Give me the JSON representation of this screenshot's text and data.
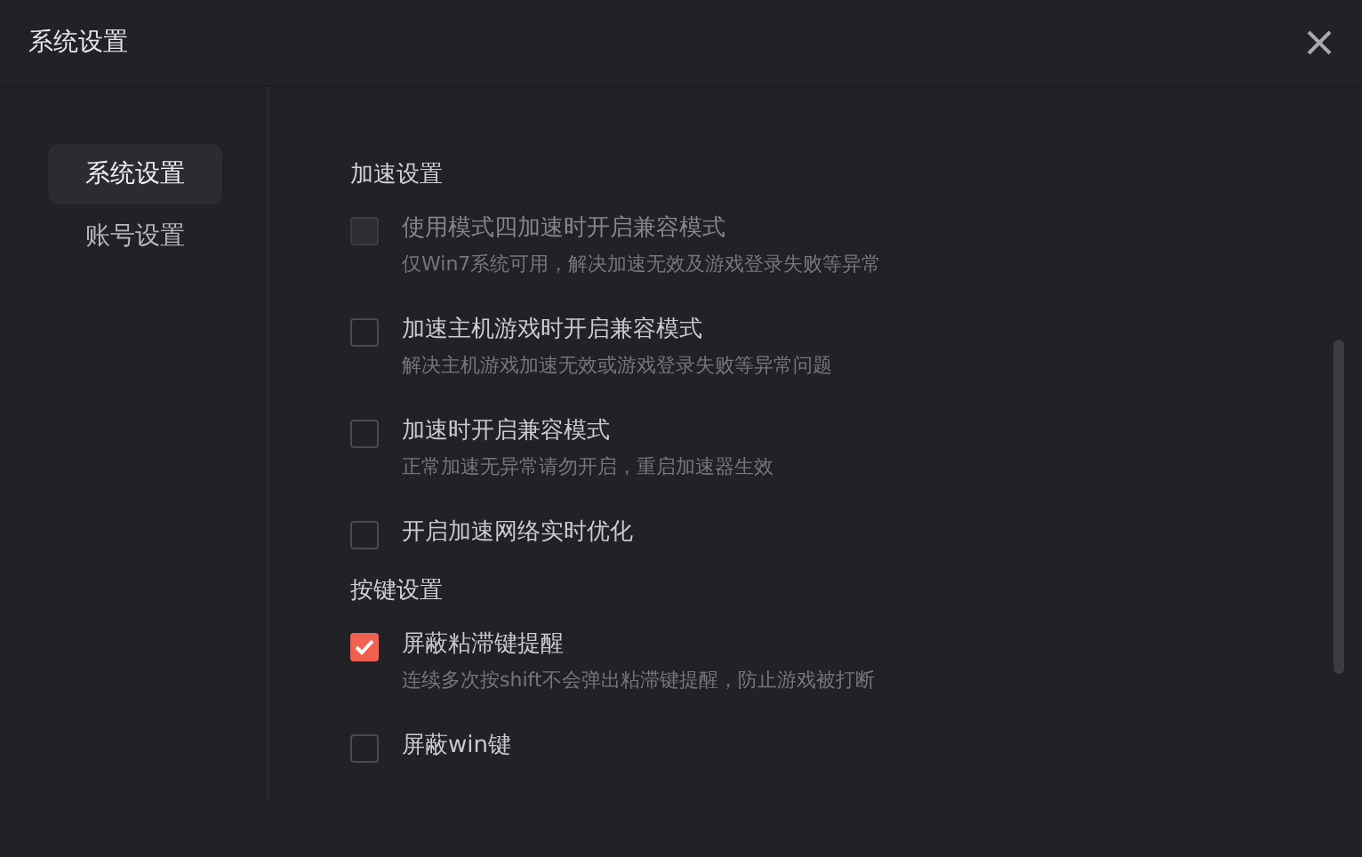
{
  "window": {
    "title": "系统设置"
  },
  "sidebar": {
    "items": [
      {
        "label": "系统设置",
        "selected": true
      },
      {
        "label": "账号设置",
        "selected": false
      }
    ]
  },
  "sections": [
    {
      "title": "加速设置",
      "options": [
        {
          "label": "使用模式四加速时开启兼容模式",
          "description": "仅Win7系统可用，解决加速无效及游戏登录失败等异常",
          "checked": false,
          "disabled": true
        },
        {
          "label": "加速主机游戏时开启兼容模式",
          "description": "解决主机游戏加速无效或游戏登录失败等异常问题",
          "checked": false,
          "disabled": false
        },
        {
          "label": "加速时开启兼容模式",
          "description": "正常加速无异常请勿开启，重启加速器生效",
          "checked": false,
          "disabled": false
        },
        {
          "label": "开启加速网络实时优化",
          "checked": false,
          "disabled": false
        }
      ]
    },
    {
      "title": "按键设置",
      "options": [
        {
          "label": "屏蔽粘滞键提醒",
          "description": "连续多次按shift不会弹出粘滞键提醒，防止游戏被打断",
          "checked": true,
          "disabled": false
        },
        {
          "label": "屏蔽win键",
          "checked": false,
          "disabled": false
        }
      ]
    }
  ]
}
